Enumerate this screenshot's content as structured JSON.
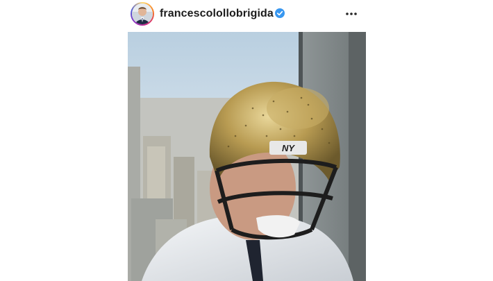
{
  "post": {
    "username": "francescolollobrigida",
    "verified": true,
    "avatar_icon": "profile-avatar",
    "more_icon": "more-options-icon",
    "photo_description_icon": "post-photo"
  },
  "colors": {
    "verified_badge": "#3897f0",
    "username_text": "#1c1c1c"
  }
}
